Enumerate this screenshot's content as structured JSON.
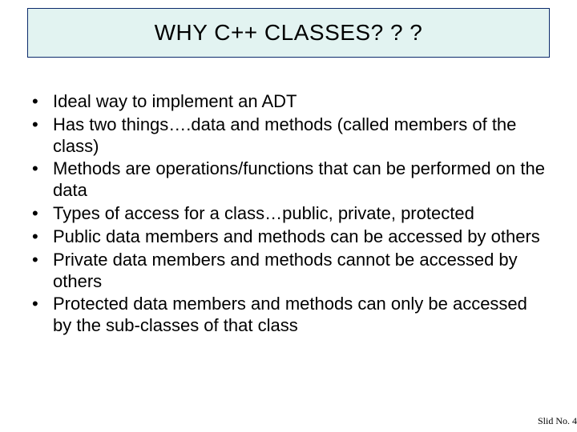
{
  "title": "WHY C++ CLASSES? ? ?",
  "bullets": [
    "Ideal way to implement an ADT",
    "Has two things….data and methods (called members of the class)",
    "Methods are operations/functions that can be performed on the data",
    "Types of access for a class…public, private, protected",
    "Public data members and methods can be accessed by others",
    "Private data members and methods cannot be accessed by others",
    "Protected data members and methods can only be accessed by the sub-classes of that class"
  ],
  "footer": "Slid No. 4"
}
